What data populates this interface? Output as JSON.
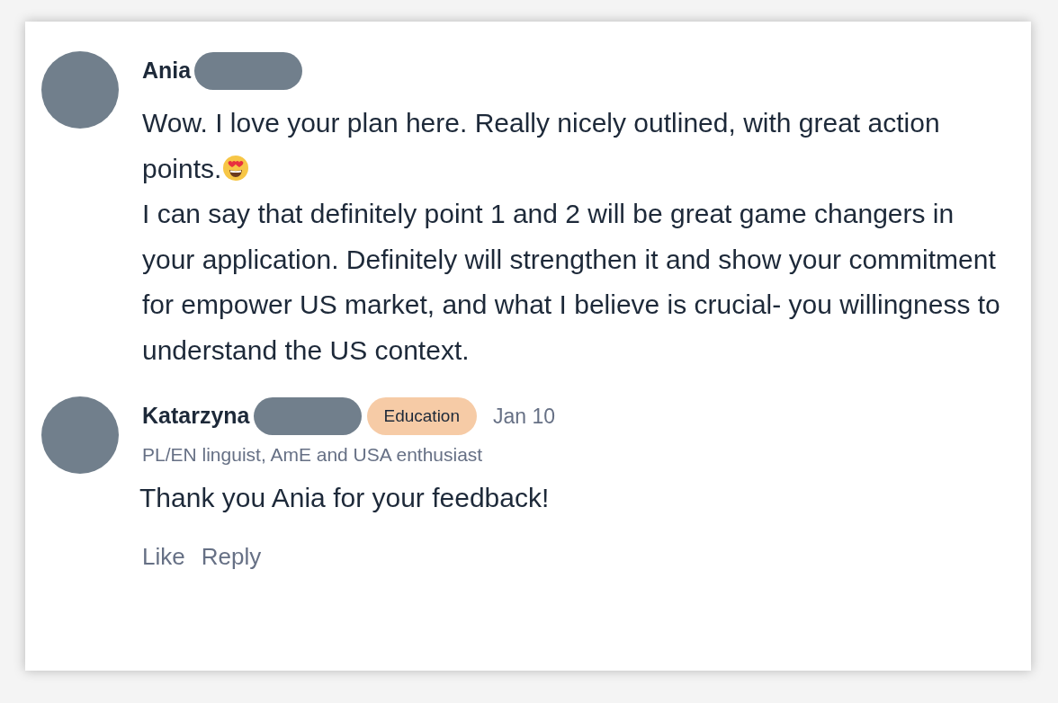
{
  "comments": [
    {
      "author": "Ania",
      "redacted_surname": true,
      "paragraphs": [
        {
          "text": "Wow. I love your plan here. Really nicely outlined, with great action points.",
          "trailing_emoji": true
        },
        {
          "text": "I can say that definitely point 1 and 2 will be great game changers in your application. Definitely will strengthen it and show your commitment for empower US market, and what I believe is crucial- you willingness to understand the US context.",
          "trailing_emoji": false
        }
      ]
    },
    {
      "author": "Katarzyna",
      "redacted_surname": true,
      "badge": {
        "label": "Education",
        "color": "#f6cba6"
      },
      "date": "Jan 10",
      "headline": "PL/EN linguist, AmE and USA enthusiast",
      "paragraphs": [
        {
          "text": "Thank you Ania for your feedback!",
          "trailing_emoji": false
        }
      ],
      "actions": [
        "Like",
        "Reply"
      ]
    }
  ]
}
